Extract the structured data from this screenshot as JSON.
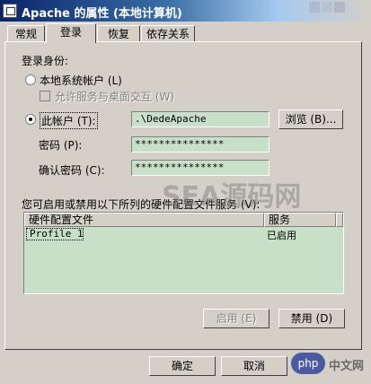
{
  "window": {
    "title": "Apache 的属性 (本地计算机)"
  },
  "tabs": [
    "常规",
    "登录",
    "恢复",
    "依存关系"
  ],
  "logon": {
    "group_label": "登录身份:",
    "local_system_label": "本地系统帐户 (L)",
    "desktop_interact_label": "允许服务与桌面交互 (W)",
    "this_account_label": "此帐户 (T):",
    "account_value": ".\\DedeApache",
    "browse_label": "浏览 (B)...",
    "password_label": "密码 (P):",
    "password_value": "***************",
    "confirm_label": "确认密码 (C):",
    "confirm_value": "***************"
  },
  "profiles": {
    "label": "您可启用或禁用以下所列的硬件配置文件服务 (V):",
    "columns": [
      "硬件配置文件",
      "服务"
    ],
    "rows": [
      {
        "profile": "Profile 1",
        "service": "已启用"
      }
    ],
    "enable_label": "启用 (E)",
    "disable_label": "禁用 (D)"
  },
  "dialog": {
    "ok_label": "确定",
    "cancel_label": "取消"
  },
  "watermark": {
    "text": "SEA源码网",
    "badge": "php",
    "site": "中文网"
  }
}
